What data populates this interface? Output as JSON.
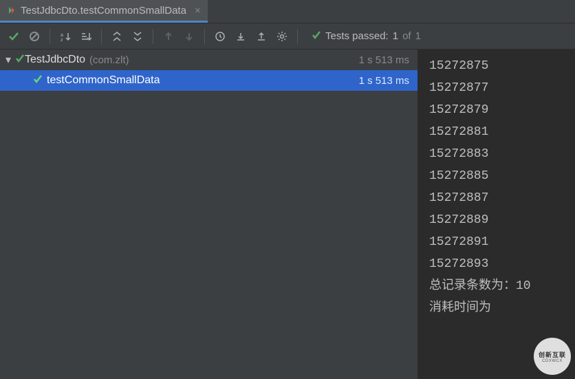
{
  "tab": {
    "title": "TestJdbcDto.testCommonSmallData"
  },
  "toolbar": {
    "status_prefix": "Tests passed:",
    "status_count": "1",
    "status_of": "of",
    "status_total": "1"
  },
  "tree": {
    "root": {
      "name": "TestJdbcDto",
      "package": "(com.zlt)",
      "time": "1 s 513 ms"
    },
    "child": {
      "name": "testCommonSmallData",
      "time": "1 s 513 ms"
    }
  },
  "console": {
    "lines": [
      "15272875",
      "15272877",
      "15272879",
      "15272881",
      "15272883",
      "15272885",
      "15272887",
      "15272889",
      "15272891",
      "15272893",
      "总记录条数为：10",
      "消耗时间为"
    ]
  },
  "watermark": {
    "top": "创新互联",
    "bottom": "CDXWCX"
  }
}
